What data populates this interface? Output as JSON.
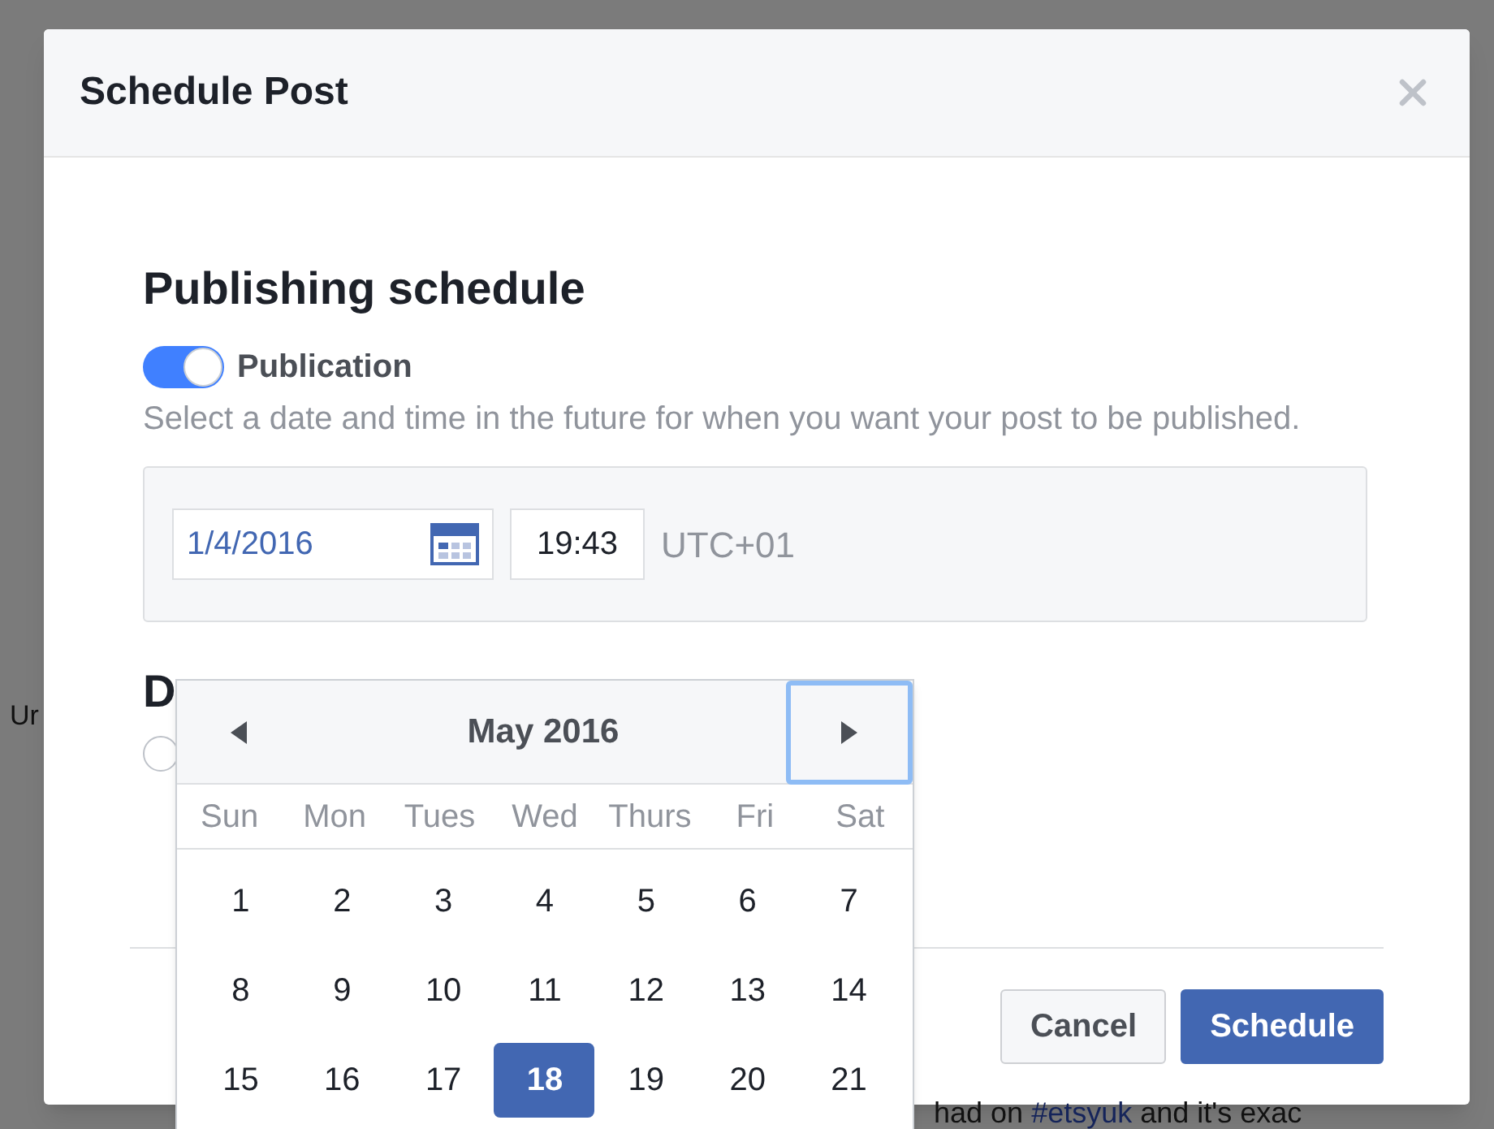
{
  "background": {
    "left_text": "Ur",
    "bottom_text_before": "had on ",
    "bottom_link": "#etsyuk",
    "bottom_text_after": " and it's exac"
  },
  "dialog": {
    "title": "Schedule Post",
    "section_title": "Publishing schedule",
    "toggle": {
      "label": "Publication",
      "on": true
    },
    "description": "Select a date and time in the future for when you want your post to be published.",
    "date": {
      "value": "1/4/2016"
    },
    "time": {
      "value": "19:43"
    },
    "timezone": "UTC+01",
    "second_section_title": "D",
    "radio": {
      "selected": false
    },
    "calendar": {
      "month": "May 2016",
      "weekdays": [
        "Sun",
        "Mon",
        "Tues",
        "Wed",
        "Thurs",
        "Fri",
        "Sat"
      ],
      "weeks": [
        [
          {
            "day": "1",
            "selected": false
          },
          {
            "day": "2",
            "selected": false
          },
          {
            "day": "3",
            "selected": false
          },
          {
            "day": "4",
            "selected": false
          },
          {
            "day": "5",
            "selected": false
          },
          {
            "day": "6",
            "selected": false
          },
          {
            "day": "7",
            "selected": false
          }
        ],
        [
          {
            "day": "8",
            "selected": false
          },
          {
            "day": "9",
            "selected": false
          },
          {
            "day": "10",
            "selected": false
          },
          {
            "day": "11",
            "selected": false
          },
          {
            "day": "12",
            "selected": false
          },
          {
            "day": "13",
            "selected": false
          },
          {
            "day": "14",
            "selected": false
          }
        ],
        [
          {
            "day": "15",
            "selected": false
          },
          {
            "day": "16",
            "selected": false
          },
          {
            "day": "17",
            "selected": false
          },
          {
            "day": "18",
            "selected": true
          },
          {
            "day": "19",
            "selected": false
          },
          {
            "day": "20",
            "selected": false
          },
          {
            "day": "21",
            "selected": false
          }
        ]
      ]
    },
    "buttons": [
      "Cancel",
      "Schedule"
    ]
  }
}
